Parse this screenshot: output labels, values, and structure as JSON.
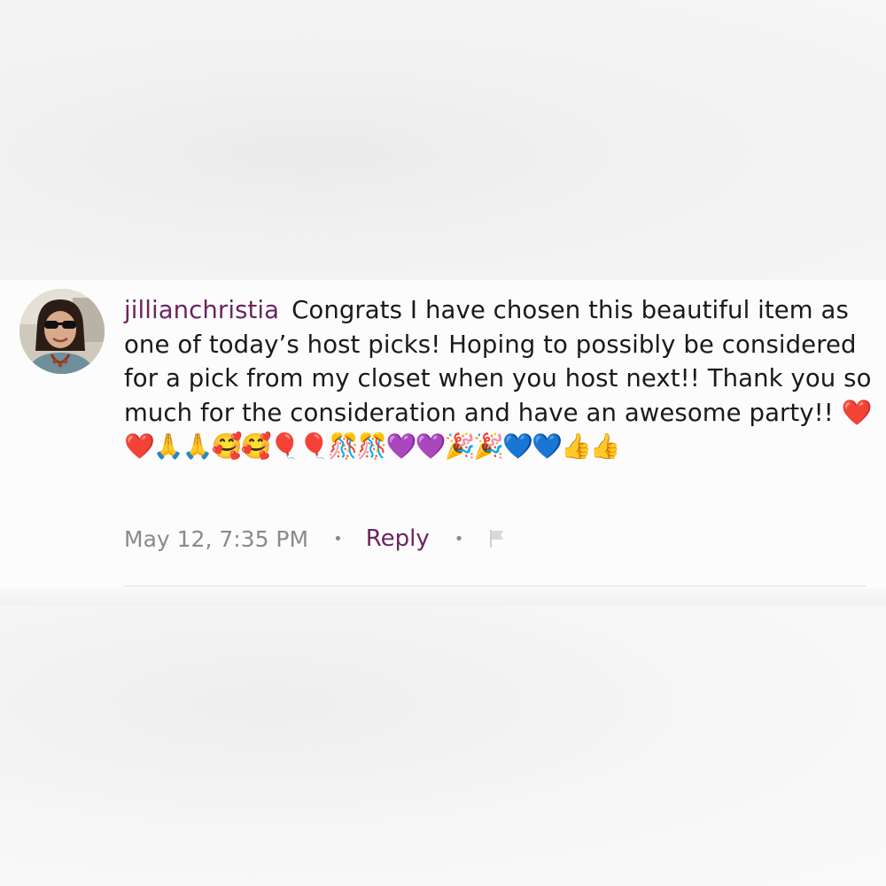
{
  "comment": {
    "username": "jillianchristia",
    "text": "Congrats I have chosen this beautiful item as one of today’s host picks! Hoping to possibly be considered for a pick from my closet when you host next!! Thank you so much for the consideration and have an awesome party!!",
    "emojis": "❤️❤️🙏🙏🥰🥰🎈🎈🎊🎊💜💜🎉🎉💙💙👍👍",
    "timestamp": "May 12, 7:35 PM",
    "separator": "•",
    "reply_label": "Reply",
    "flag_icon": "flag-icon"
  },
  "colors": {
    "username": "#6b2560",
    "reply": "#6b2560",
    "meta": "#8a8a8a",
    "text": "#1a1a1a"
  }
}
